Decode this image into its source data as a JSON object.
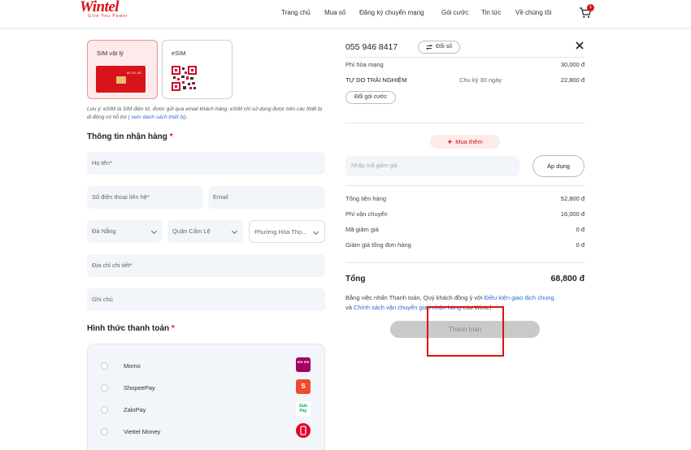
{
  "brand": {
    "logo_text_a": "Win",
    "logo_text_b": "tel",
    "tagline": "Give You Power",
    "accent": "#d7141a"
  },
  "nav": {
    "items": [
      "Trang chủ",
      "Mua số",
      "Đăng ký chuyển mạng",
      "Gói cước",
      "Tin tức",
      "Về chúng tôi"
    ],
    "cart_count": "1"
  },
  "sim_type": {
    "physical_label": "SIM vật lý",
    "esim_label": "eSIM",
    "selected": "SIM vật lý",
    "sim_card_text": "5G 4G 3G"
  },
  "note": {
    "text": "Lưu ý: eSIM là SIM điện tử, được gửi qua email khách hàng. eSIM chỉ sử dụng được trên các thiết bị di động có hỗ trợ (",
    "link": " xem danh sách thiết bị",
    "end": ")."
  },
  "shipping": {
    "title": "Thông tin nhận hàng",
    "required_mark": "*",
    "name_placeholder": "Họ tên*",
    "phone_placeholder": "Số điện thoại liên hệ*",
    "email_placeholder": "Email",
    "province": "Đà Nẵng",
    "district": "Quận Cẩm Lệ",
    "ward": "Phường Hòa Thọ...",
    "address_placeholder": "Địa chỉ chi tiết*",
    "note_placeholder": "Ghi chú"
  },
  "payment": {
    "title": "Hình thức thanh toán",
    "required_mark": "*",
    "methods": [
      {
        "name": "Momo",
        "logo": "momo-logo",
        "logo_text": "mo mo",
        "color": "#a50064"
      },
      {
        "name": "ShopeePay",
        "logo": "shopeepay-logo",
        "logo_text": "S",
        "color": "#ee4d2d"
      },
      {
        "name": "ZaloPay",
        "logo": "zalopay-logo",
        "logo_text": "Zalo Pay",
        "color": "#00a859"
      },
      {
        "name": "Viettel Money",
        "logo": "viettel-money-logo",
        "logo_text": "",
        "color": "#e4002b"
      }
    ]
  },
  "order": {
    "phone_number": "055 946 8417",
    "change_number_label": "Đổi số",
    "network_fee_label": "Phí hòa mạng",
    "network_fee_value": "30,000 đ",
    "plan_name": "TỰ DO TRẢI NGHIỆM",
    "plan_cycle": "Chu kỳ 30 ngày",
    "plan_price": "22,800 đ",
    "change_plan_label": "Đổi gói cước",
    "buy_more_label": "Mua thêm",
    "promo_placeholder": "Nhập mã giảm giá",
    "apply_label": "Áp dụng",
    "subtotal_label": "Tổng tiền hàng",
    "subtotal_value": "52,800 đ",
    "shipping_label": "Phí vận chuyển",
    "shipping_value": "16,000 đ",
    "discount_label": "Mã giảm giá",
    "discount_value": "0 đ",
    "order_discount_label": "Giảm giá tổng đơn hàng",
    "order_discount_value": "0 đ",
    "total_label": "Tổng",
    "total_value": "68,800 đ",
    "terms_prefix": "Bằng việc nhấn Thanh toán, Quý khách đồng ý với ",
    "terms_link1": "Điều kiện giao dịch chung",
    "terms_and": "và ",
    "terms_link2": "Chính sách vận chuyển giao nhận hàng",
    "terms_suffix": " của Wintel",
    "pay_button": "Thanh toán"
  }
}
